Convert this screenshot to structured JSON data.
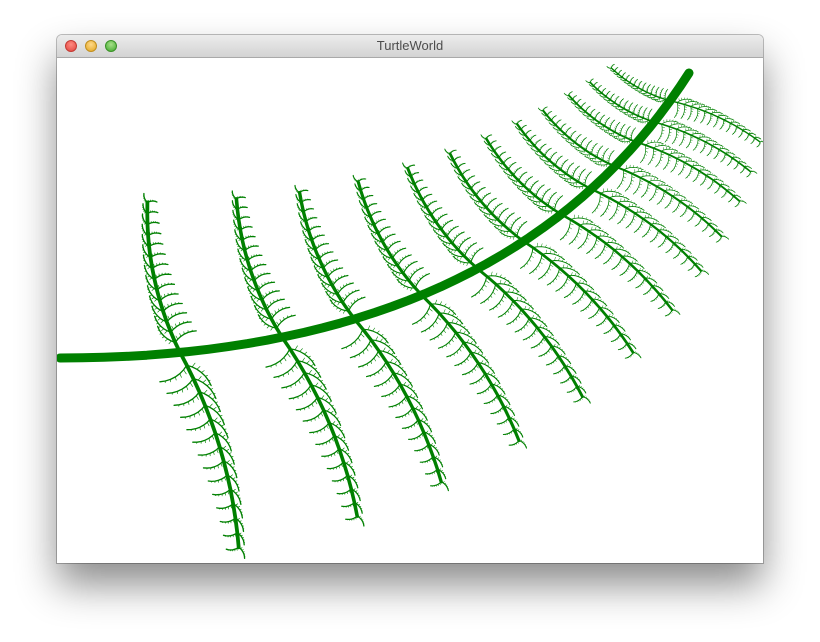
{
  "window": {
    "title": "TurtleWorld"
  },
  "controls": {
    "close_icon": "close-traffic-light-icon",
    "minimize_icon": "minimize-traffic-light-icon",
    "zoom_icon": "zoom-traffic-light-icon"
  },
  "drawing": {
    "subject": "fern",
    "stroke_color": "#008000",
    "background_color": "#ffffff"
  }
}
